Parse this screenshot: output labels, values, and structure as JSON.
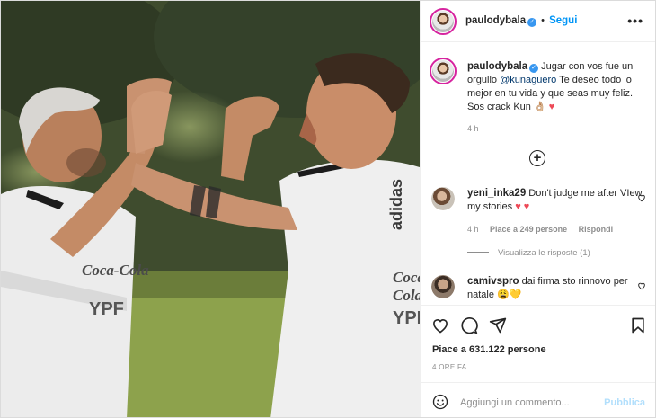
{
  "post": {
    "username": "paulodybala",
    "follow_label": "Segui",
    "more_label": "•••",
    "caption_text": "Jugar con vos fue un orgullo ",
    "caption_mention": "@kunaguero",
    "caption_rest": " Te deseo todo lo mejor en tu vida y que seas muy feliz. Sos crack Kun 👌🏼",
    "caption_hearts": "♥",
    "time": "4 h"
  },
  "comments": [
    {
      "username": "yeni_inka29",
      "text": "Don't judge me after VIew my stories",
      "hearts": "♥ ♥",
      "time": "4 h",
      "likes": "Piace a 249 persone",
      "reply": "Rispondi",
      "view_replies": "Visualizza le risposte (1)"
    },
    {
      "username": "camivspro",
      "text": "dai firma sto rinnovo per natale",
      "emoji": "😩💛"
    }
  ],
  "footer": {
    "likes": "Piace a 631.122 persone",
    "ago": "4 ORE FA",
    "comment_placeholder": "Aggiungi un commento...",
    "publish_label": "Pubblica"
  },
  "photo": {
    "left_shirt_text": "Coca-Cola",
    "left_shirt_sponsor": "YPF",
    "right_shirt_brand": "adidas",
    "right_shirt_text": "Coca-Cola",
    "right_shirt_sponsor": "YPF"
  },
  "icons": [
    "verified-icon",
    "more-icon",
    "add-comment-icon",
    "heart-icon",
    "comment-icon",
    "share-icon",
    "bookmark-icon",
    "emoji-icon"
  ],
  "colors": {
    "link": "#0095f6",
    "mention": "#00376b",
    "muted": "#8e8e8e",
    "heart": "#ed4956",
    "publish": "#b2dffc"
  }
}
